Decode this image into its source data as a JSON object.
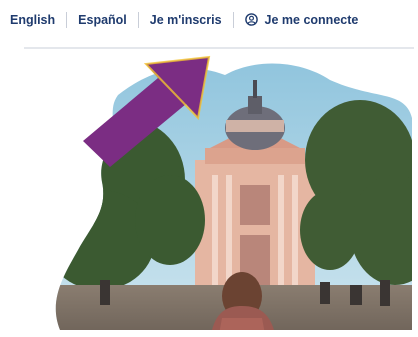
{
  "nav": {
    "links": [
      {
        "label": "English"
      },
      {
        "label": "Español"
      },
      {
        "label": "Je m'inscris"
      },
      {
        "label": "Je me connecte"
      }
    ],
    "user_icon": "user-circle-icon"
  },
  "colors": {
    "nav_text": "#1f3b6e",
    "arrow": "#7b2d83",
    "sky": "#9ccbe0",
    "building": "#e7b9a6",
    "trees": "#3e5a33"
  },
  "hero": {
    "arrow_icon": "pointing-arrow-icon",
    "photo": "sorbonne-chapel-photo"
  }
}
